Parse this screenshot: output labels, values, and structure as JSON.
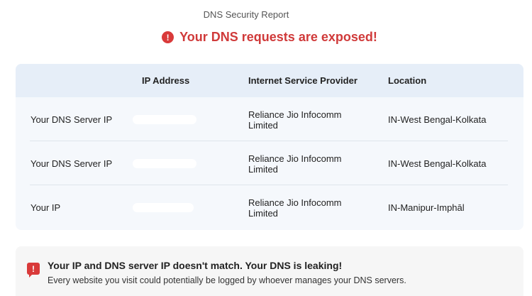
{
  "header": {
    "report_title": "DNS Security Report",
    "alert_text": "Your DNS requests are exposed!",
    "alert_icon": "exclamation-circle-icon"
  },
  "table": {
    "columns": [
      "",
      "IP Address",
      "Internet Service Provider",
      "Location"
    ],
    "rows": [
      {
        "label": "Your DNS Server IP",
        "ip": "",
        "isp": "Reliance Jio Infocomm Limited",
        "location": "IN-West Bengal-Kolkata"
      },
      {
        "label": "Your DNS Server IP",
        "ip": "",
        "isp": "Reliance Jio Infocomm Limited",
        "location": "IN-West Bengal-Kolkata"
      },
      {
        "label": "Your IP",
        "ip": "",
        "isp": "Reliance Jio Infocomm Limited",
        "location": "IN-Manipur-Imphāl"
      }
    ]
  },
  "leak_notice": {
    "icon": "exclamation-speech-icon",
    "title": "Your IP and DNS server IP doesn't match. Your DNS is leaking!",
    "description": "Every website you visit could potentially be logged by whoever manages your DNS servers."
  },
  "colors": {
    "alert_red": "#d03a3a",
    "table_bg": "#f5f8fc",
    "table_header_bg": "#e6eef8"
  }
}
